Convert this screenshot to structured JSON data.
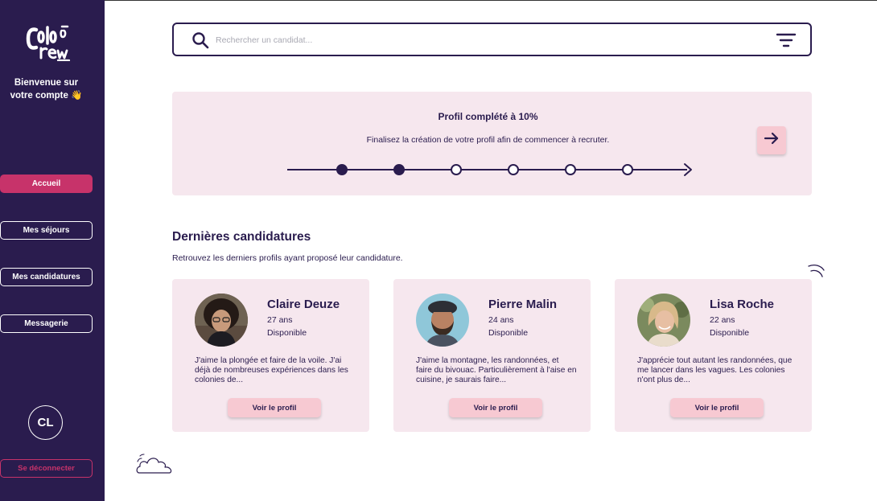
{
  "brand": {
    "logo_alt": "Colo Crew",
    "accent": "#c7336a",
    "sidebar_bg": "#2a1c4e",
    "card_bg": "#f6e7ee",
    "button_bg": "#f7c9d2"
  },
  "sidebar": {
    "welcome_line1": "Bienvenue sur",
    "welcome_line2": "votre compte 👋",
    "items": [
      {
        "label": "Accueil",
        "active": true
      },
      {
        "label": "Mes séjours",
        "active": false
      },
      {
        "label": "Mes candidatures",
        "active": false
      },
      {
        "label": "Messagerie",
        "active": false
      }
    ],
    "avatar_initials": "CL",
    "logout_label": "Se déconnecter"
  },
  "search": {
    "placeholder": "Rechercher un candidat...",
    "icon": "search-icon",
    "filter_icon": "filter-icon"
  },
  "progress": {
    "title": "Profil complété à 10%",
    "subtitle": "Finalisez la création de votre profil afin de commencer à recruter.",
    "steps_total": 6,
    "steps_done": 2,
    "next_icon": "arrow-right-icon"
  },
  "applications": {
    "title": "Dernières candidatures",
    "subtitle": "Retrouvez les derniers profils ayant proposé leur candidature.",
    "candidates": [
      {
        "name": "Claire Deuze",
        "age": "27 ans",
        "status": "Disponible",
        "bio": "J'aime la plongée et faire de la voile. J'ai déjà de nombreuses expériences dans les colonies de...",
        "button": "Voir le profil"
      },
      {
        "name": "Pierre Malin",
        "age": "24 ans",
        "status": "Disponible",
        "bio": "J'aime la montagne, les randonnées, et faire du bivouac. Particulièrement à l'aise en cuisine, je saurais faire...",
        "button": "Voir le profil"
      },
      {
        "name": "Lisa Roche",
        "age": "22 ans",
        "status": "Disponible",
        "bio": "J'apprécie tout autant les randonnées, que me lancer dans les vagues. Les colonies n'ont plus de...",
        "button": "Voir le profil"
      }
    ]
  }
}
